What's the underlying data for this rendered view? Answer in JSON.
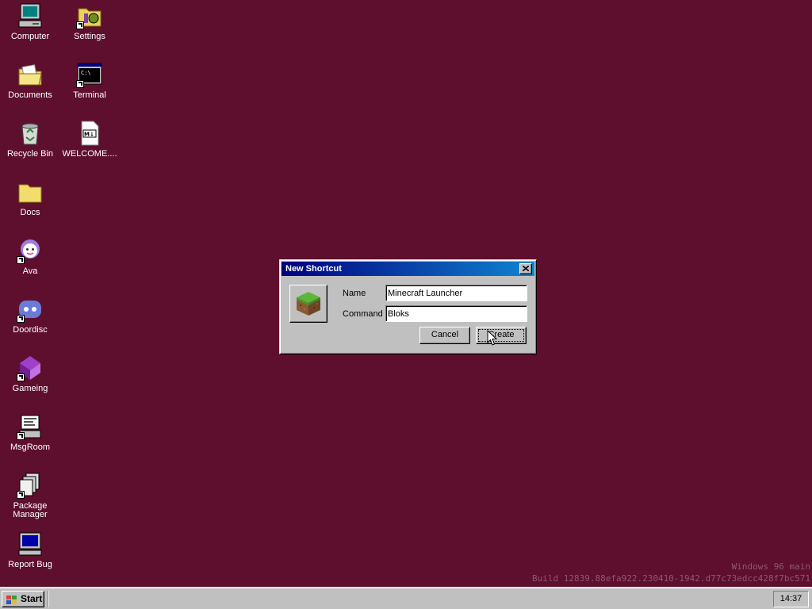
{
  "desktop": {
    "icons": [
      {
        "label": "Computer",
        "icon": "computer-icon"
      },
      {
        "label": "Settings",
        "icon": "settings-icon"
      },
      {
        "label": "Documents",
        "icon": "documents-folder-icon"
      },
      {
        "label": "Terminal",
        "icon": "terminal-icon"
      },
      {
        "label": "Recycle Bin",
        "icon": "recycle-bin-icon"
      },
      {
        "label": "WELCOME....",
        "icon": "markdown-file-icon"
      },
      {
        "label": "Docs",
        "icon": "folder-icon"
      },
      {
        "label": "Ava",
        "icon": "ava-icon"
      },
      {
        "label": "Doordisc",
        "icon": "doordisc-icon"
      },
      {
        "label": "Gameing",
        "icon": "gameing-icon"
      },
      {
        "label": "MsgRoom",
        "icon": "msgroom-icon"
      },
      {
        "label": "Package Manager",
        "icon": "package-manager-icon"
      },
      {
        "label": "Report Bug",
        "icon": "report-bug-icon"
      }
    ]
  },
  "dialog": {
    "title": "New Shortcut",
    "name_label": "Name",
    "name_value": "Minecraft Launcher",
    "command_label": "Command",
    "command_value": "Bloks",
    "cancel_label": "Cancel",
    "create_label": "Create"
  },
  "watermark": {
    "line1": "Windows 96 main",
    "line2": "Build 12839.88efa922.230410-1942.d77c73edcc428f7bc571"
  },
  "taskbar": {
    "start_label": "Start",
    "clock": "14:37"
  },
  "colors": {
    "desktop_bg": "#5e0f2d",
    "titlebar_start": "#000080",
    "titlebar_end": "#1084d0",
    "face": "#c0c0c0"
  }
}
